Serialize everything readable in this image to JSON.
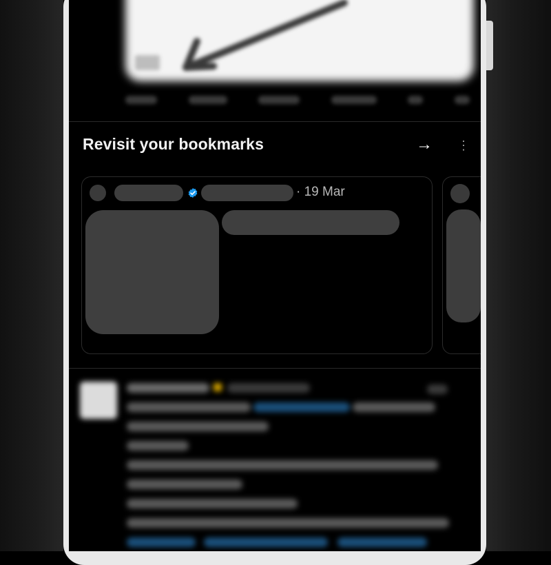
{
  "bookmarks_section": {
    "title": "Revisit your bookmarks",
    "open_label": "→",
    "more_label": "⋮"
  },
  "bookmark_card": {
    "date": "· 19 Mar",
    "verified_color": "#1d9bf0"
  },
  "colors": {
    "background": "#000000",
    "placeholder": "#3d3d3d",
    "link_blue": "#1d9bf0",
    "gold_badge": "#d4a400"
  }
}
